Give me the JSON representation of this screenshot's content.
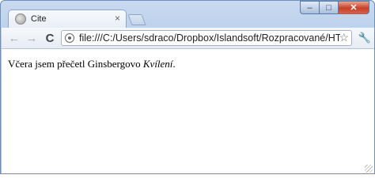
{
  "tab": {
    "title": "Cite",
    "close": "×"
  },
  "window_controls": {
    "minimize": "–",
    "maximize": "□",
    "close": "✕"
  },
  "toolbar": {
    "back": "←",
    "forward": "→",
    "reload": "C",
    "url": "file:///C:/Users/sdraco/Dropbox/Islandsoft/Rozpracované/HTML/",
    "star": "☆",
    "wrench": "🔧"
  },
  "page": {
    "text_before": "Včera jsem přečetl Ginsbergovo ",
    "title_italic": "Kvílení",
    "text_after": "."
  }
}
